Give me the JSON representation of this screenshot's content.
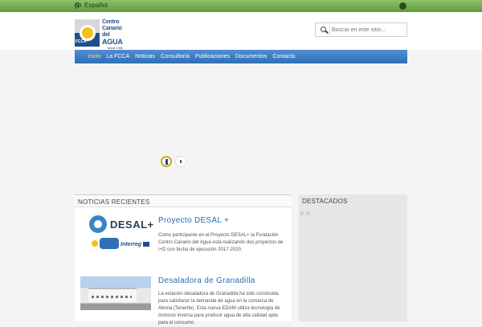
{
  "topbar": {
    "language": "Español"
  },
  "header": {
    "logo": {
      "line1": "Centro",
      "line2": "Canario",
      "line3": "del",
      "line4": "AGUA",
      "since": "desde 1986",
      "mark_text": "FCCA"
    },
    "search": {
      "placeholder": "Buscar en este sitio..."
    }
  },
  "nav": {
    "items": [
      "Inicio",
      "La FCCA",
      "Noticias",
      "Consultoría",
      "Publicaciones",
      "Documentos",
      "Contacto"
    ],
    "active_index": 0
  },
  "slider": {
    "slide_count": 2
  },
  "news": {
    "heading": "NOTICIAS RECIENTES",
    "items": [
      {
        "title": "Proyecto DESAL +",
        "text": "Como participante en el Proyecto DESAL+ la Fundación Centro Canario del Agua está realizando dos proyectos de I+D con fecha de ejecución 2017-2020.",
        "thumb_word": "DESAL+",
        "thumb_program": "Interreg"
      },
      {
        "title": "Desaladora de Granadilla",
        "text": "La estación desaladora de Granadilla ha sido construida para satisfacer la demanda de agua en la comarca de Abona (Tenerife). Esta nueva EDAM utiliza tecnología de ósmosis inversa para producir agua de alta calidad apta para el consumo"
      }
    ]
  },
  "featured": {
    "heading": "DESTACADOS"
  },
  "colors": {
    "topbar": "#6fae4c",
    "nav": "#3c7dc4",
    "link": "#2b6cb3",
    "brand_blue": "#1f4e8c",
    "brand_yellow": "#f2c219"
  }
}
